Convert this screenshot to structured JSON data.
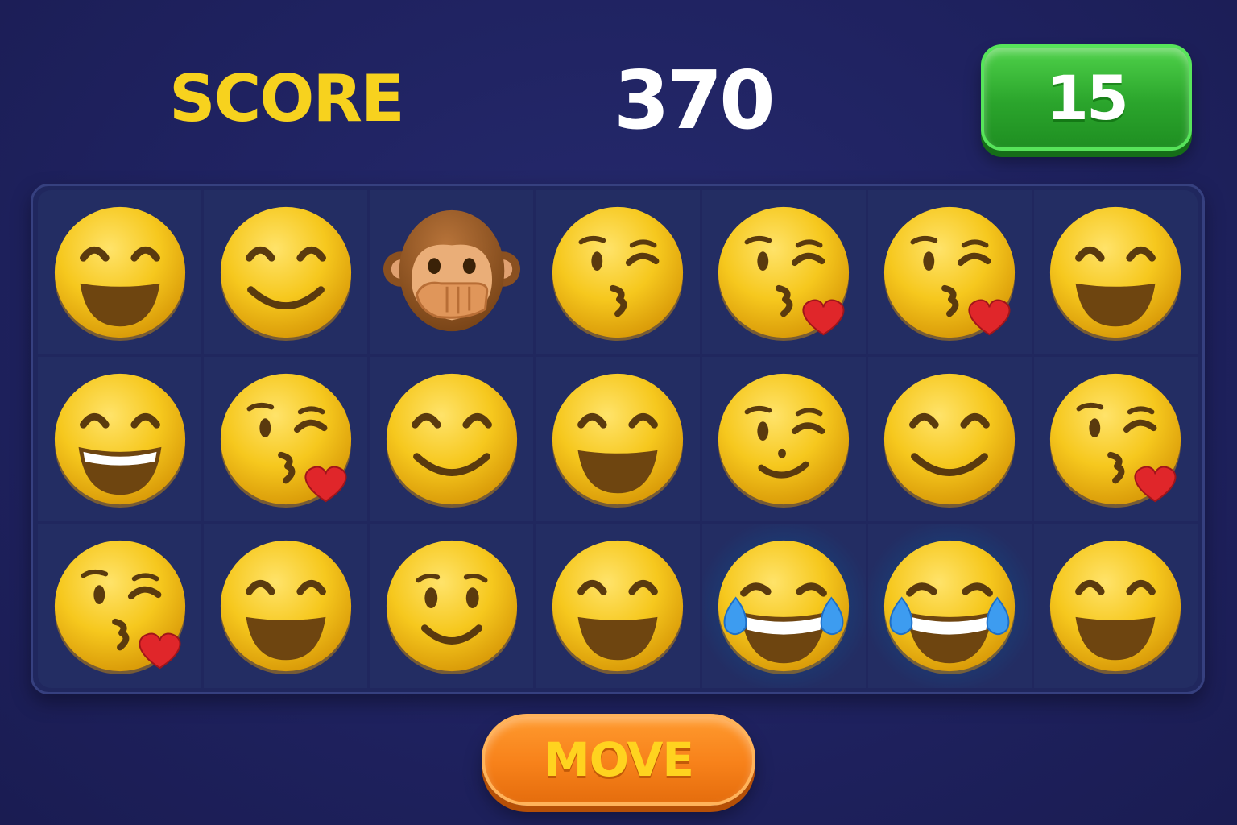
{
  "hud": {
    "score_label": "SCORE",
    "score_value": "370",
    "moves_remaining": "15"
  },
  "controls": {
    "move_label": "MOVE"
  },
  "colors": {
    "background": "#1f2260",
    "score_label": "#f7d21e",
    "moves_badge": "#2ba52c",
    "move_button": "#f7811a",
    "tile_face": "#f6c81e",
    "highlight": "#1c5b8f"
  },
  "board": {
    "rows": 3,
    "cols": 7,
    "cells": [
      [
        {
          "icon": "grinning-smiling-eyes-emoji",
          "type": "grin"
        },
        {
          "icon": "smiling-face-emoji",
          "type": "smile"
        },
        {
          "icon": "speak-no-evil-monkey-emoji",
          "type": "monkey"
        },
        {
          "icon": "kissing-wink-emoji",
          "type": "kiss"
        },
        {
          "icon": "face-blowing-kiss-emoji",
          "type": "kissheart"
        },
        {
          "icon": "face-blowing-kiss-emoji",
          "type": "kissheart"
        },
        {
          "icon": "grinning-smiling-eyes-emoji",
          "type": "grin"
        }
      ],
      [
        {
          "icon": "beaming-face-emoji",
          "type": "beam"
        },
        {
          "icon": "face-blowing-kiss-emoji",
          "type": "kissheart"
        },
        {
          "icon": "smiling-face-emoji",
          "type": "smile"
        },
        {
          "icon": "grinning-smiling-eyes-emoji",
          "type": "grin"
        },
        {
          "icon": "winking-face-emoji",
          "type": "wink"
        },
        {
          "icon": "smiling-face-emoji",
          "type": "smile"
        },
        {
          "icon": "face-blowing-kiss-emoji",
          "type": "kissheart"
        }
      ],
      [
        {
          "icon": "face-blowing-kiss-emoji",
          "type": "kissheart"
        },
        {
          "icon": "grinning-smiling-eyes-emoji",
          "type": "grin"
        },
        {
          "icon": "slightly-smiling-face-emoji",
          "type": "slight"
        },
        {
          "icon": "grinning-smiling-eyes-emoji",
          "type": "grin"
        },
        {
          "icon": "tears-of-joy-emoji",
          "type": "joy",
          "highlighted": true
        },
        {
          "icon": "tears-of-joy-emoji",
          "type": "joy",
          "highlighted": true
        },
        {
          "icon": "grinning-smiling-eyes-emoji",
          "type": "grin"
        }
      ]
    ]
  }
}
